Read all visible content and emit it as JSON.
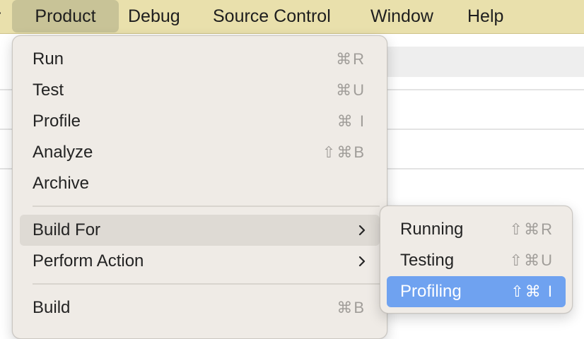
{
  "menubar": {
    "cut_label": "r",
    "items": [
      "Product",
      "Debug",
      "Source Control",
      "Window",
      "Help"
    ],
    "active": "Product"
  },
  "product_menu": {
    "items": [
      {
        "label": "Run",
        "shortcut": "⌘R"
      },
      {
        "label": "Test",
        "shortcut": "⌘U"
      },
      {
        "label": "Profile",
        "shortcut": "⌘ I"
      },
      {
        "label": "Analyze",
        "shortcut": "⇧⌘B"
      },
      {
        "label": "Archive",
        "shortcut": ""
      },
      {
        "label": "Build For",
        "submenu": true,
        "highlighted": true
      },
      {
        "label": "Perform Action",
        "submenu": true
      },
      {
        "label": "Build",
        "shortcut": "⌘B"
      }
    ]
  },
  "build_for_submenu": {
    "items": [
      {
        "label": "Running",
        "shortcut": "⇧⌘R"
      },
      {
        "label": "Testing",
        "shortcut": "⇧⌘U"
      },
      {
        "label": "Profiling",
        "shortcut": "⇧⌘ I",
        "selected": true
      }
    ]
  },
  "colors": {
    "menubar_bg": "#e9e0ac",
    "menu_bg": "#efebe6",
    "selection": "#6fa2f0"
  }
}
